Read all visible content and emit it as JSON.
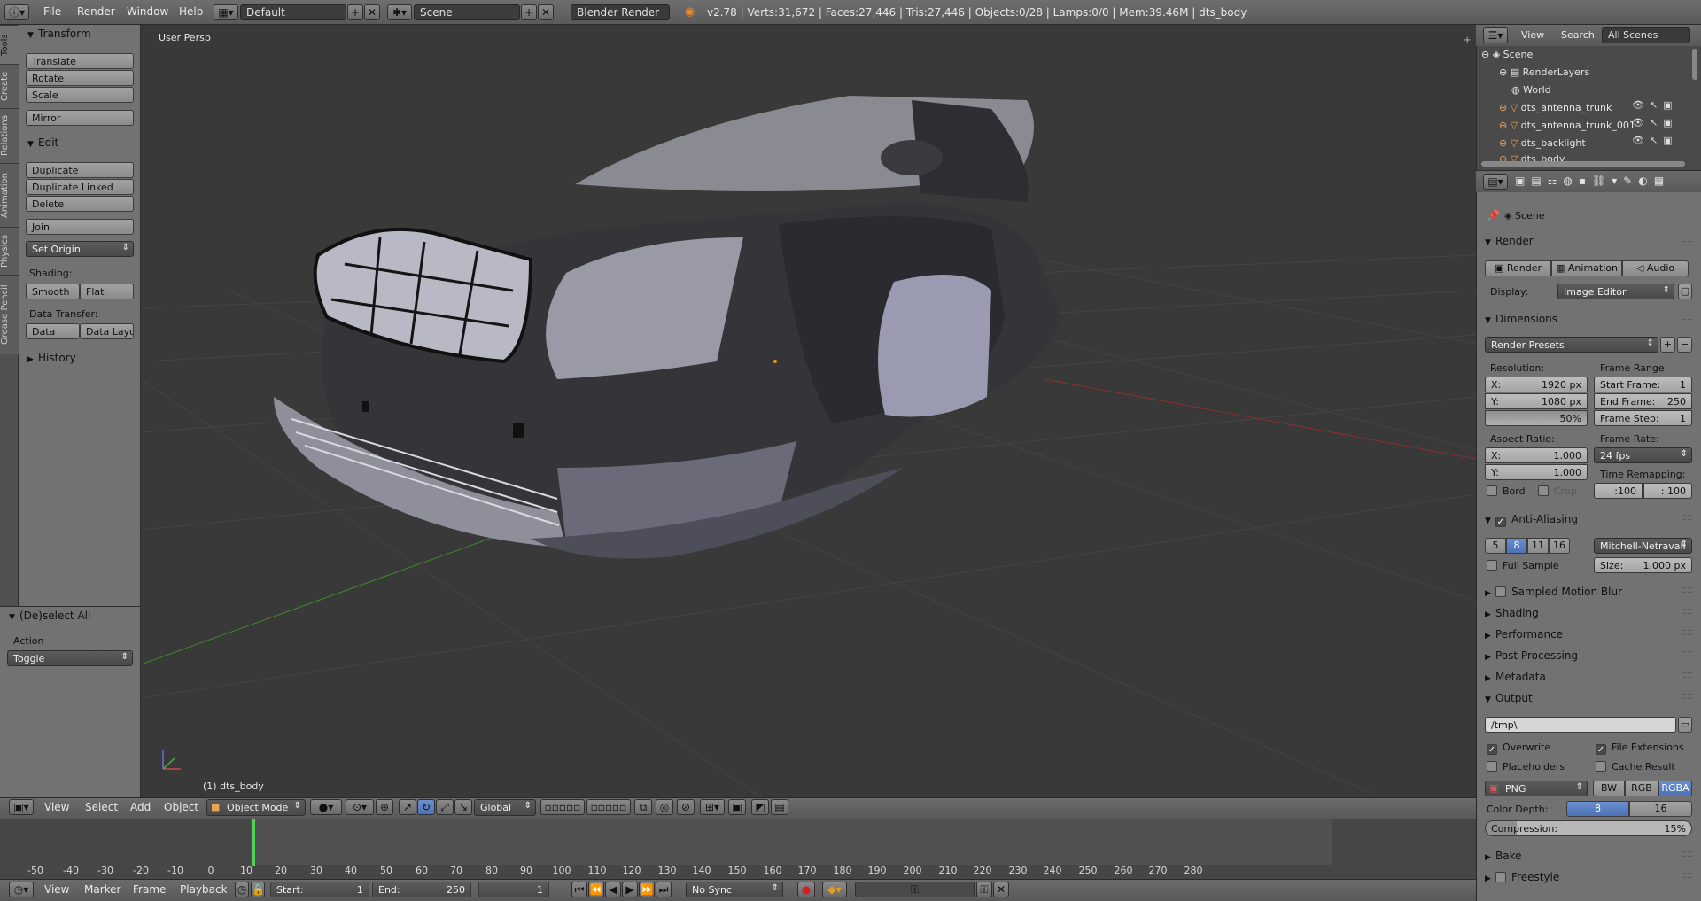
{
  "topbar": {
    "menus": [
      "File",
      "Render",
      "Window",
      "Help"
    ],
    "layout": "Default",
    "scene": "Scene",
    "engine": "Blender Render",
    "stats": "v2.78 | Verts:31,672 | Faces:27,446 | Tris:27,446 | Objects:0/28 | Lamps:0/0 | Mem:39.46M | dts_body"
  },
  "tabs": [
    "Tools",
    "Create",
    "Relations",
    "Animation",
    "Physics",
    "Grease Pencil"
  ],
  "tools": {
    "transform": {
      "title": "Transform",
      "buttons": [
        "Translate",
        "Rotate",
        "Scale",
        "Mirror"
      ]
    },
    "edit": {
      "title": "Edit",
      "buttons": [
        "Duplicate",
        "Duplicate Linked",
        "Delete",
        "Join"
      ],
      "set_origin": "Set Origin"
    },
    "shading": {
      "label": "Shading:",
      "smooth": "Smooth",
      "flat": "Flat"
    },
    "data_transfer": {
      "label": "Data Transfer:",
      "data": "Data",
      "data_layout": "Data Layo"
    },
    "history": "History"
  },
  "operator": {
    "title": "(De)select All",
    "action_label": "Action",
    "action_value": "Toggle"
  },
  "viewport": {
    "view_name": "User Persp",
    "object_label": "(1) dts_body"
  },
  "view_header": {
    "menus": [
      "View",
      "Select",
      "Add",
      "Object"
    ],
    "mode": "Object Mode",
    "orientation": "Global"
  },
  "timeline": {
    "ticks": [
      "-50",
      "-40",
      "-30",
      "-20",
      "-10",
      "0",
      "10",
      "20",
      "30",
      "40",
      "50",
      "60",
      "70",
      "80",
      "90",
      "100",
      "110",
      "120",
      "130",
      "140",
      "150",
      "160",
      "170",
      "180",
      "190",
      "200",
      "210",
      "220",
      "230",
      "240",
      "250",
      "260",
      "270",
      "280"
    ],
    "menus": [
      "View",
      "Marker",
      "Frame",
      "Playback"
    ],
    "start_label": "Start:",
    "start": "1",
    "end_label": "End:",
    "end": "250",
    "current": "1",
    "sync": "No Sync"
  },
  "outliner": {
    "menus": [
      "View",
      "Search"
    ],
    "filter": "All Scenes",
    "items": [
      "Scene",
      "RenderLayers",
      "World",
      "dts_antenna_trunk",
      "dts_antenna_trunk_001",
      "dts_backlight",
      "dts_body"
    ]
  },
  "properties": {
    "context": "Scene",
    "render": {
      "title": "Render",
      "buttons": [
        "Render",
        "Animation",
        "Audio"
      ],
      "display_label": "Display:",
      "display_value": "Image Editor"
    },
    "dimensions": {
      "title": "Dimensions",
      "presets": "Render Presets",
      "resolution_label": "Resolution:",
      "res_x_label": "X:",
      "res_x": "1920 px",
      "res_y_label": "Y:",
      "res_y": "1080 px",
      "res_pct": "50%",
      "frame_range_label": "Frame Range:",
      "start_label": "Start Frame:",
      "start": "1",
      "end_label": "End Frame:",
      "end": "250",
      "step_label": "Frame Step:",
      "step": "1",
      "aspect_label": "Aspect Ratio:",
      "asp_x_label": "X:",
      "asp_x": "1.000",
      "asp_y_label": "Y:",
      "asp_y": "1.000",
      "frame_rate_label": "Frame Rate:",
      "frame_rate": "24 fps",
      "remap_label": "Time Remapping:",
      "remap_old": ":100",
      "remap_new": ": 100",
      "bord": "Bord",
      "crop": "Crop"
    },
    "antialiasing": {
      "title": "Anti-Aliasing",
      "samples": [
        "5",
        "8",
        "11",
        "16"
      ],
      "filter": "Mitchell-Netravali",
      "full_sample": "Full Sample",
      "size_label": "Size:",
      "size": "1.000 px"
    },
    "collapsed": [
      "Sampled Motion Blur",
      "Shading",
      "Performance",
      "Post Processing",
      "Metadata"
    ],
    "output": {
      "title": "Output",
      "path": "/tmp\\",
      "overwrite": "Overwrite",
      "file_extensions": "File Extensions",
      "placeholders": "Placeholders",
      "cache_result": "Cache Result",
      "format": "PNG",
      "color_modes": [
        "BW",
        "RGB",
        "RGBA"
      ],
      "depth_label": "Color Depth:",
      "depths": [
        "8",
        "16"
      ],
      "compression_label": "Compression:",
      "compression": "15%"
    },
    "bottom": [
      "Bake",
      "Freestyle"
    ]
  },
  "colors": {
    "accent": "#5680c2",
    "x_axis": "#8c2f2f",
    "y_axis": "#3f8a2c",
    "playhead": "#4fd14f"
  }
}
